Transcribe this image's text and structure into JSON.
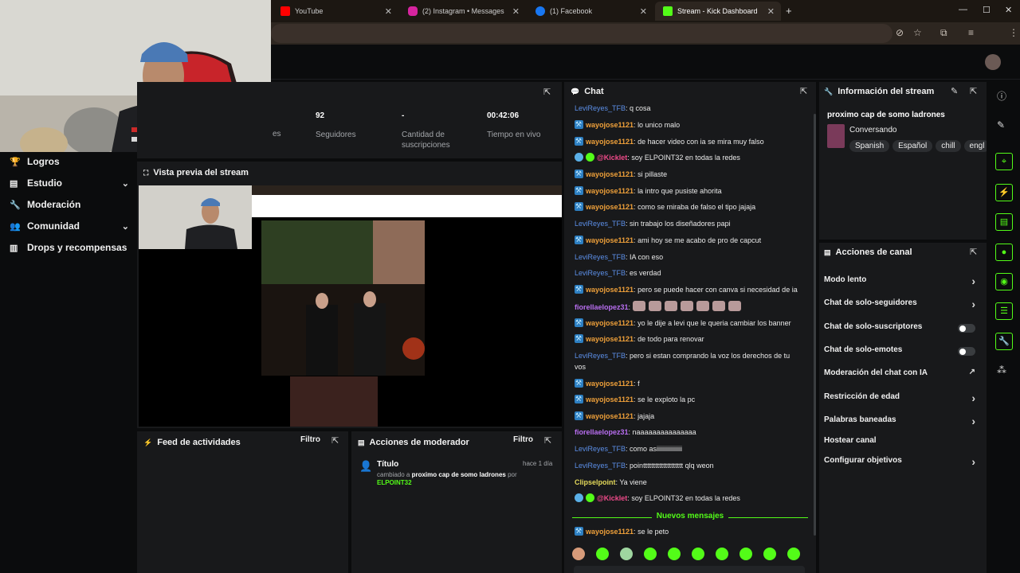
{
  "browser": {
    "tabs": [
      {
        "label": "YouTube",
        "icon": "youtube-icon",
        "color": "#ff0000"
      },
      {
        "label": "(2) Instagram • Messages",
        "icon": "instagram-icon",
        "color": "#d6249f"
      },
      {
        "label": "(1) Facebook",
        "icon": "facebook-icon",
        "color": "#1877f2"
      },
      {
        "label": "Stream - Kick Dashboard",
        "icon": "kick-icon",
        "color": "#53fc18"
      }
    ],
    "new_tab": "+",
    "window_controls": [
      "—",
      "☐",
      "✕"
    ]
  },
  "sidebar": {
    "items": [
      {
        "label": "Logros",
        "icon": "trophy-icon",
        "glyph": "🏆",
        "chevron": false
      },
      {
        "label": "Estudio",
        "icon": "studio-icon",
        "glyph": "▤",
        "chevron": true
      },
      {
        "label": "Moderación",
        "icon": "wrench-icon",
        "glyph": "🔧",
        "chevron": false
      },
      {
        "label": "Comunidad",
        "icon": "community-icon",
        "glyph": "👥",
        "chevron": true
      },
      {
        "label": "Drops y recompensas",
        "icon": "drops-icon",
        "glyph": "▥",
        "chevron": false
      }
    ]
  },
  "stats": {
    "partial_label": "es",
    "items": [
      {
        "value": "92",
        "label": "Seguidores"
      },
      {
        "value": "-",
        "label": "Cantidad de suscripciones"
      },
      {
        "value": "00:42:06",
        "label": "Tiempo en vivo"
      }
    ]
  },
  "preview": {
    "title": "Vista previa del stream"
  },
  "activity_feed": {
    "title": "Feed de actividades",
    "filter": "Filtro"
  },
  "mod_actions": {
    "title": "Acciones de moderador",
    "filter": "Filtro",
    "entry": {
      "title": "Título",
      "time": "hace 1 día",
      "changed": "cambiado a",
      "new_title": "proximo cap de somo ladrones",
      "by": "por",
      "user": "ELPOINT32"
    }
  },
  "chat": {
    "title": "Chat",
    "messages": [
      {
        "user": "LeviReyes_TFB",
        "style": "blue",
        "badge": "",
        "text": "q cosa"
      },
      {
        "user": "wayojose1121",
        "style": "orange",
        "badge": "mod",
        "text": "lo unico malo"
      },
      {
        "user": "wayojose1121",
        "style": "orange",
        "badge": "mod",
        "text": "de hacer video con ia se mira muy falso"
      },
      {
        "user": "@Kicklet",
        "style": "pink",
        "badge": "bot",
        "text": "soy ELPOINT32 en todas la redes"
      },
      {
        "user": "wayojose1121",
        "style": "orange",
        "badge": "mod",
        "text": "si pillaste"
      },
      {
        "user": "wayojose1121",
        "style": "orange",
        "badge": "mod",
        "text": "la intro que pusiste ahorita"
      },
      {
        "user": "wayojose1121",
        "style": "orange",
        "badge": "mod",
        "text": "como se miraba de falso el tipo jajaja"
      },
      {
        "user": "LeviReyes_TFB",
        "style": "blue",
        "badge": "",
        "text": "sin trabajo los diseñadores papi"
      },
      {
        "user": "wayojose1121",
        "style": "orange",
        "badge": "mod",
        "text": "ami hoy se me acabo de pro de capcut"
      },
      {
        "user": "LeviReyes_TFB",
        "style": "blue",
        "badge": "",
        "text": "IA con eso"
      },
      {
        "user": "LeviReyes_TFB",
        "style": "blue",
        "badge": "",
        "text": "es verdad"
      },
      {
        "user": "wayojose1121",
        "style": "orange",
        "badge": "mod",
        "text": "pero se puede hacer con canva si necesidad de ia"
      },
      {
        "user": "fiorellaelopez31",
        "style": "purple",
        "badge": "",
        "text": "",
        "emotes": 7
      },
      {
        "user": "wayojose1121",
        "style": "orange",
        "badge": "mod",
        "text": "yo le dije a levi que le queria cambiar los banner"
      },
      {
        "user": "wayojose1121",
        "style": "orange",
        "badge": "mod",
        "text": "de todo para renovar"
      },
      {
        "user": "LeviReyes_TFB",
        "style": "blue",
        "badge": "",
        "text": "pero si estan comprando la voz los derechos de tu vos"
      },
      {
        "user": "wayojose1121",
        "style": "orange",
        "badge": "mod",
        "text": "f"
      },
      {
        "user": "wayojose1121",
        "style": "orange",
        "badge": "mod",
        "text": "se le exploto la pc"
      },
      {
        "user": "wayojose1121",
        "style": "orange",
        "badge": "mod",
        "text": "jajaja"
      },
      {
        "user": "fiorellaelopez31",
        "style": "purple",
        "badge": "",
        "text": "naaaaaaaaaaaaaaa"
      },
      {
        "user": "LeviReyes_TFB",
        "style": "blue",
        "badge": "",
        "text": "como asiiiiiiiiiiiiiiii"
      },
      {
        "user": "LeviReyes_TFB",
        "style": "blue",
        "badge": "",
        "text": "pointttttttttttttttttttt qlq weon"
      },
      {
        "user": "Clipselpoint",
        "style": "yellow",
        "badge": "",
        "text": "Ya viene"
      },
      {
        "user": "@Kicklet",
        "style": "pink",
        "badge": "bot",
        "text": "soy ELPOINT32 en todas la redes"
      }
    ],
    "new_messages_label": "Nuevos mensajes",
    "after": {
      "user": "wayojose1121",
      "style": "orange",
      "badge": "mod",
      "text": "se le peto"
    }
  },
  "stream_info": {
    "title": "Información del stream",
    "stream_title": "proximo cap de somo ladrones",
    "category": "Conversando",
    "tags": [
      "Spanish",
      "Español",
      "chill",
      "engl"
    ]
  },
  "channel_actions": {
    "title": "Acciones de canal",
    "items": [
      {
        "label": "Modo lento",
        "control": "chevron"
      },
      {
        "label": "Chat de solo-seguidores",
        "control": "chevron"
      },
      {
        "label": "Chat de solo-suscriptores",
        "control": "toggle"
      },
      {
        "label": "Chat de solo-emotes",
        "control": "toggle"
      },
      {
        "label": "Moderación del chat con IA",
        "control": "external"
      },
      {
        "label": "Restricción de edad",
        "control": "chevron"
      },
      {
        "label": "Palabras baneadas",
        "control": "chevron"
      },
      {
        "label": "Hostear canal",
        "control": "none"
      },
      {
        "label": "Configurar objetivos",
        "control": "chevron"
      }
    ]
  },
  "colors": {
    "accent": "#53fc18",
    "panel": "#18191b",
    "background": "#0b0c0d"
  }
}
